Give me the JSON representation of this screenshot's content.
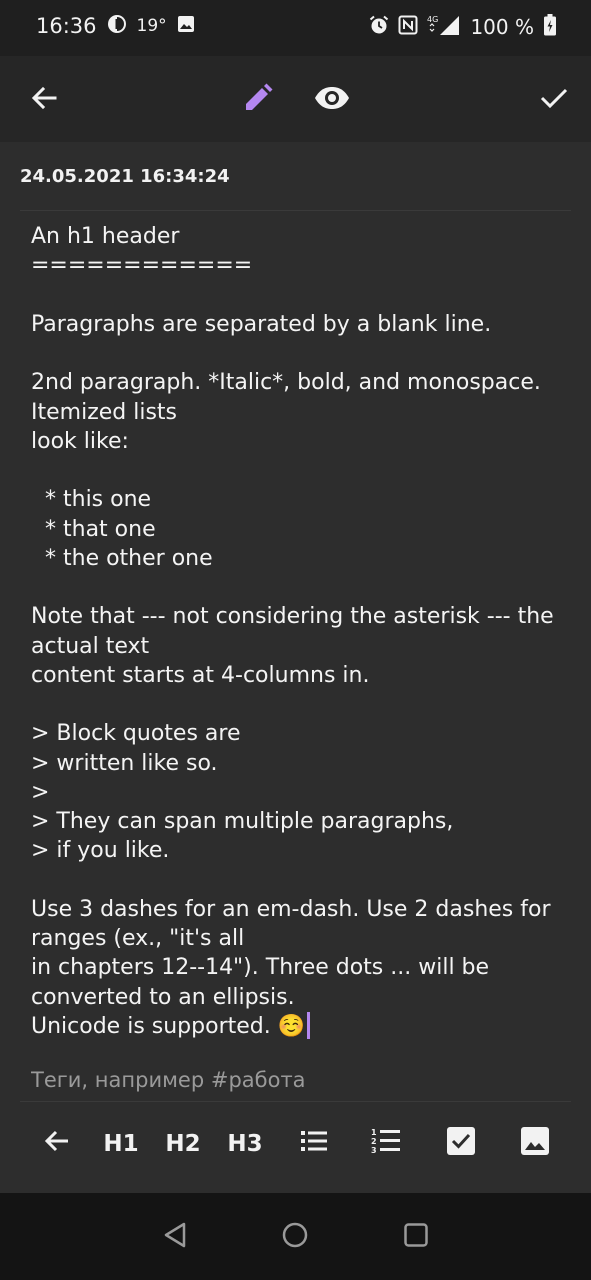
{
  "status_bar": {
    "time": "16:36",
    "temperature": "19°",
    "battery": "100 %"
  },
  "app_bar": {
    "icons": [
      "arrow-left-icon",
      "pencil-icon",
      "eye-icon",
      "check-icon"
    ],
    "accent_color": "#b487f0"
  },
  "note": {
    "date": "24.05.2021 16:34:24",
    "body": "An h1 header\n============\n\nParagraphs are separated by a blank line.\n\n2nd paragraph. *Italic*, bold, and monospace.\nItemized lists\nlook like:\n\n  * this one\n  * that one\n  * the other one\n\nNote that --- not considering the asterisk --- the actual text\ncontent starts at 4-columns in.\n\n> Block quotes are\n> written like so.\n>\n> They can span multiple paragraphs,\n> if you like.\n\nUse 3 dashes for an em-dash. Use 2 dashes for ranges (ex., \"it's all\nin chapters 12--14\"). Three dots ... will be converted to an ellipsis.\nUnicode is supported. ☺️",
    "tags_placeholder": "Теги, например #работа"
  },
  "format_toolbar": {
    "h1": "H1",
    "h2": "H2",
    "h3": "H3",
    "icons": [
      "arrow-left-icon",
      "bullet-list-icon",
      "numbered-list-icon",
      "checkbox-icon",
      "image-icon"
    ]
  },
  "nav_bar": {
    "icons": [
      "back-triangle-icon",
      "home-circle-icon",
      "recents-square-icon"
    ]
  }
}
